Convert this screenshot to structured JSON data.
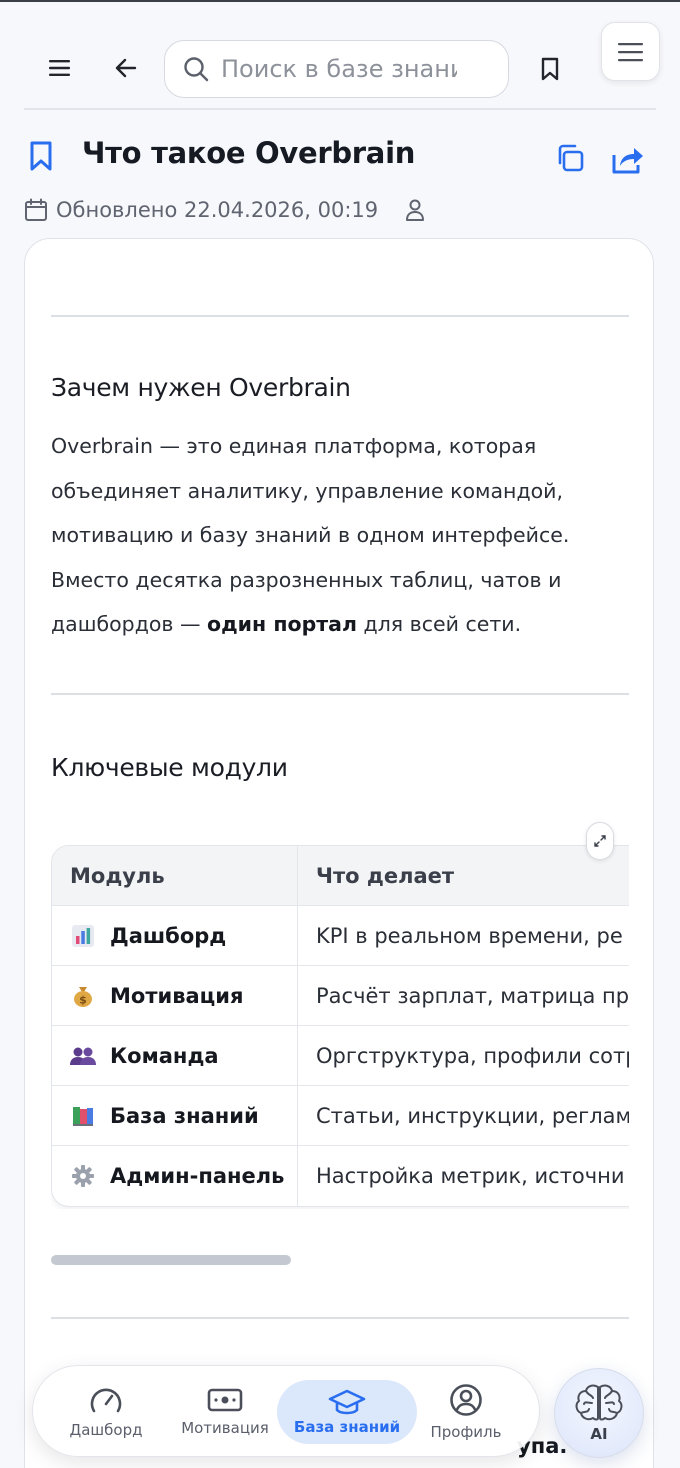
{
  "header": {
    "search_placeholder": "Поиск в базе знаний"
  },
  "article": {
    "title": "Что такое Overbrain",
    "updated": "Обновлено 22.04.2026, 00:19",
    "section1_heading": "Зачем нужен Overbrain",
    "section1_text_before": "Overbrain — это единая платформа, которая объединяет аналитику, управление командой, мотивацию и базу знаний в одном интерфейсе. Вместо десятка разрозненных таблиц, чатов и дашбордов — ",
    "section1_text_bold": "один портал",
    "section1_text_after": " для всей сети.",
    "section2_heading": "Ключевые модули",
    "bottom_partial_text": "упа."
  },
  "table": {
    "headers": [
      "Модуль",
      "Что делает"
    ],
    "rows": [
      {
        "icon": "bar-chart-icon",
        "module": "Дашборд",
        "desc": "KPI в реальном времени, ре"
      },
      {
        "icon": "money-bag-icon",
        "module": "Мотивация",
        "desc": "Расчёт зарплат, матрица пр"
      },
      {
        "icon": "people-icon",
        "module": "Команда",
        "desc": "Оргструктура, профили сотр"
      },
      {
        "icon": "books-icon",
        "module": "База знаний",
        "desc": "Статьи, инструкции, реглам"
      },
      {
        "icon": "gear-icon",
        "module": "Админ-панель",
        "desc": "Настройка метрик, источни"
      }
    ]
  },
  "bottom_nav": {
    "items": [
      {
        "label": "Дашборд",
        "icon": "speedometer-icon"
      },
      {
        "label": "Мотивация",
        "icon": "banknote-icon"
      },
      {
        "label": "База знаний",
        "icon": "graduation-cap-icon",
        "active": true
      },
      {
        "label": "Профиль",
        "icon": "user-circle-icon"
      }
    ],
    "ai_label": "AI"
  },
  "colors": {
    "accent": "#2a6ef0",
    "active_nav_bg": "#dbe7fb",
    "text": "#1f2430"
  }
}
